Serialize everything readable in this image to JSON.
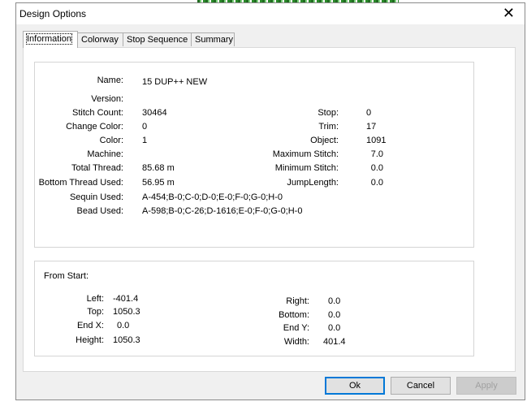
{
  "window": {
    "title": "Design Options",
    "close_glyph": "✕"
  },
  "tabs": [
    {
      "label": "Information",
      "active": true
    },
    {
      "label": "Colorway",
      "active": false
    },
    {
      "label": "Stop Sequence",
      "active": false
    },
    {
      "label": "Summary",
      "active": false
    }
  ],
  "info": {
    "name_label": "Name:",
    "name_value": "15 DUP++ NEW",
    "version_label": "Version:",
    "version_value": "",
    "stitch_count_label": "Stitch Count:",
    "stitch_count_value": "30464",
    "change_color_label": "Change Color:",
    "change_color_value": "0",
    "color_label": "Color:",
    "color_value": "1",
    "machine_label": "Machine:",
    "machine_value": "",
    "total_thread_label": "Total Thread:",
    "total_thread_value": "85.68 m",
    "bottom_thread_label": "Bottom Thread Used:",
    "bottom_thread_value": "56.95 m",
    "sequin_label": "Sequin Used:",
    "sequin_value": "A-454;B-0;C-0;D-0;E-0;F-0;G-0;H-0",
    "bead_label": "Bead Used:",
    "bead_value": "A-598;B-0;C-26;D-1616;E-0;F-0;G-0;H-0",
    "stop_label": "Stop:",
    "stop_value": "0",
    "trim_label": "Trim:",
    "trim_value": "17",
    "object_label": "Object:",
    "object_value": "1091",
    "max_stitch_label": "Maximum Stitch:",
    "max_stitch_value": "7.0",
    "min_stitch_label": "Minimum Stitch:",
    "min_stitch_value": "0.0",
    "jump_length_label": "JumpLength:",
    "jump_length_value": "0.0"
  },
  "from_start": {
    "heading": "From Start:",
    "left_label": "Left:",
    "left_value": "-401.4",
    "top_label": "Top:",
    "top_value": "1050.3",
    "end_x_label": "End X:",
    "end_x_value": "0.0",
    "height_label": "Height:",
    "height_value": "1050.3",
    "right_label": "Right:",
    "right_value": "0.0",
    "bottom_label": "Bottom:",
    "bottom_value": "0.0",
    "end_y_label": "End Y:",
    "end_y_value": "0.0",
    "width_label": "Width:",
    "width_value": "401.4"
  },
  "buttons": {
    "ok": "Ok",
    "cancel": "Cancel",
    "apply": "Apply"
  }
}
